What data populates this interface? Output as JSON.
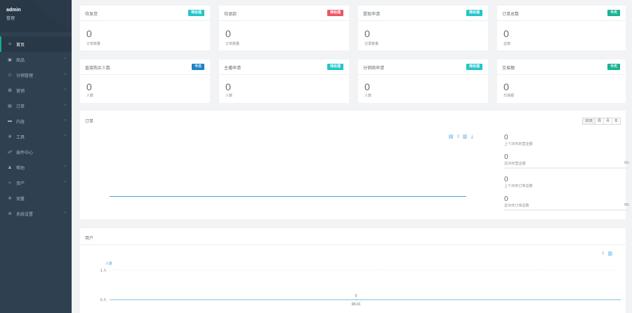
{
  "user": {
    "name": "admin",
    "role": "管理"
  },
  "sidebar": {
    "items": [
      {
        "label": "首页",
        "icon": "home-icon",
        "glyph": "⌂",
        "active": true,
        "arrow": ""
      },
      {
        "label": "商品",
        "icon": "goods-icon",
        "glyph": "▣",
        "active": false,
        "arrow": "‹"
      },
      {
        "label": "分销管理",
        "icon": "distribution-icon",
        "glyph": "⚇",
        "active": false,
        "arrow": "‹"
      },
      {
        "label": "营销",
        "icon": "marketing-icon",
        "glyph": "✪",
        "active": false,
        "arrow": "‹"
      },
      {
        "label": "订单",
        "icon": "order-icon",
        "glyph": "▤",
        "active": false,
        "arrow": "‹"
      },
      {
        "label": "内容",
        "icon": "content-icon",
        "glyph": "▬",
        "active": false,
        "arrow": "‹"
      },
      {
        "label": "工具",
        "icon": "tools-icon",
        "glyph": "✲",
        "active": false,
        "arrow": "‹"
      },
      {
        "label": "插件中心",
        "icon": "plugin-icon",
        "glyph": "☍",
        "active": false,
        "arrow": ""
      },
      {
        "label": "帮助",
        "icon": "help-icon",
        "glyph": "♟",
        "active": false,
        "arrow": "‹"
      },
      {
        "label": "资产",
        "icon": "assets-icon",
        "glyph": "✧",
        "active": false,
        "arrow": "‹"
      },
      {
        "label": "测量",
        "icon": "measure-icon",
        "glyph": "✲",
        "active": false,
        "arrow": ""
      },
      {
        "label": "系统设置",
        "icon": "settings-icon",
        "glyph": "✲",
        "active": false,
        "arrow": "‹"
      }
    ]
  },
  "cards": [
    {
      "title": "待发货",
      "badge": "待处理",
      "badge_color": "#23c6c8",
      "value": "0",
      "sub": "订单数量"
    },
    {
      "title": "待退款",
      "badge": "待处理",
      "badge_color": "#ed5565",
      "value": "0",
      "sub": "订单数量"
    },
    {
      "title": "提现申请",
      "badge": "待处理",
      "badge_color": "#23c6c8",
      "value": "0",
      "sub": "记录数量"
    },
    {
      "title": "订单总数",
      "badge": "今天",
      "badge_color": "#1ab394",
      "value": "0",
      "sub": "总数"
    },
    {
      "title": "直接购买人数",
      "badge": "今日",
      "badge_color": "#1c84c6",
      "value": "0",
      "sub": "人数"
    },
    {
      "title": "主播申请",
      "badge": "待处理",
      "badge_color": "#23c6c8",
      "value": "0",
      "sub": "人数"
    },
    {
      "title": "分销商申请",
      "badge": "待处理",
      "badge_color": "#23c6c8",
      "value": "0",
      "sub": "人数"
    },
    {
      "title": "交易额",
      "badge": "今天",
      "badge_color": "#1ab394",
      "value": "0",
      "sub": "交易额"
    }
  ],
  "orders": {
    "title": "订单",
    "ranges": [
      "30天",
      "周",
      "月",
      "年"
    ],
    "stats": [
      {
        "value": "0",
        "label": "上个30天的营业额",
        "percent": ""
      },
      {
        "value": "0",
        "label": "近30天营业额",
        "percent": "0%"
      },
      {
        "value": "0",
        "label": "上个30天订单总数",
        "percent": ""
      },
      {
        "value": "0",
        "label": "近30天订单总数",
        "percent": "0%"
      }
    ]
  },
  "users": {
    "title": "用户",
    "chart_data": {
      "type": "line",
      "series": [
        {
          "name": "人数",
          "values": [
            0
          ]
        }
      ],
      "x": [
        "08-01"
      ],
      "y_ticks": [
        "1 人",
        "0 人"
      ],
      "data_labels": [
        "0"
      ],
      "ylim": [
        0,
        1
      ]
    }
  },
  "colors": {
    "sidebar": "#2f4050",
    "accent": "#19aa8d",
    "line": "#46a6e0"
  }
}
